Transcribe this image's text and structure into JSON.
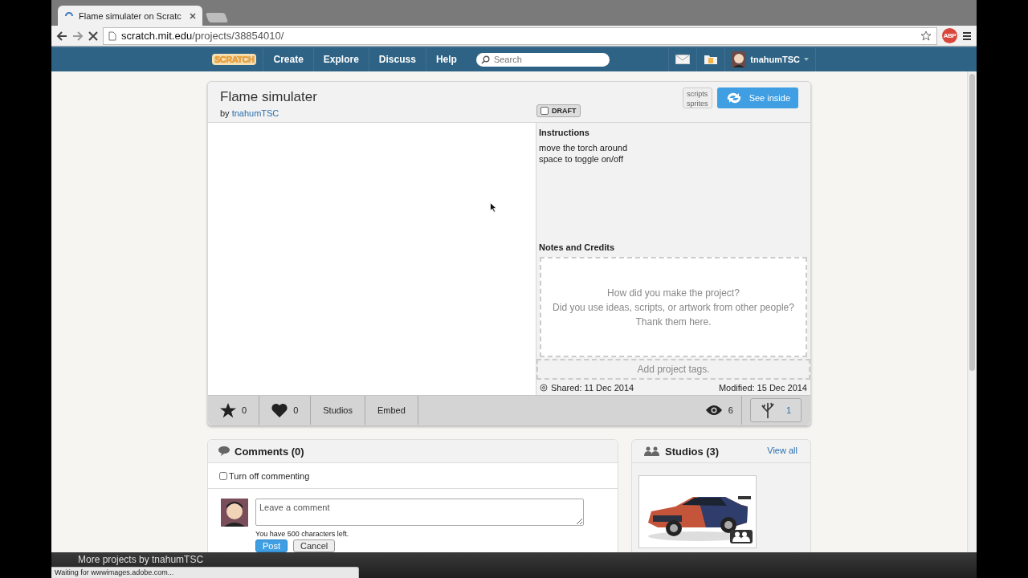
{
  "browser": {
    "tab_title": "Flame simulater on Scratc",
    "url_host": "scratch.mit.edu",
    "url_path": "/projects/38854010/",
    "extension_label": "ABP"
  },
  "nav": {
    "logo": "SCRATCH",
    "items": [
      "Create",
      "Explore",
      "Discuss",
      "Help"
    ],
    "search": {
      "placeholder": "Search"
    },
    "username": "tnahumTSC"
  },
  "project": {
    "title": "Flame simulater",
    "by": "by",
    "author": "tnahumTSC",
    "draft": {
      "label": "DRAFT",
      "checked": false
    },
    "hint_lines": [
      "scripts",
      "sprites"
    ],
    "see_inside": "See inside",
    "instructions": {
      "heading": "Instructions",
      "lines": [
        "move the torch around",
        "space to toggle on/off"
      ]
    },
    "notes": {
      "heading": "Notes and Credits",
      "placeholder": "How did you make the project?\nDid you use ideas, scripts, or artwork from other people? Thank them here."
    },
    "tags": {
      "placeholder": "Add project tags."
    },
    "shared": "Shared: 11 Dec 2014",
    "modified": "Modified: 15 Dec 2014",
    "stats": {
      "favorites": "0",
      "loves": "0",
      "studios": "Studios",
      "embed": "Embed",
      "views": "6",
      "remixes": "1"
    }
  },
  "comments": {
    "title": "Comments (0)",
    "turn_off": {
      "label": "Turn off commenting",
      "checked": false
    },
    "placeholder": "Leave a comment",
    "chars_left": "You have 500 characters left.",
    "post": "Post",
    "cancel": "Cancel"
  },
  "studios": {
    "title": "Studios (3)",
    "view_all": "View all"
  },
  "footer": {
    "more": "More projects by tnahumTSC",
    "status": "Waiting for wwwimages.adobe.com..."
  }
}
